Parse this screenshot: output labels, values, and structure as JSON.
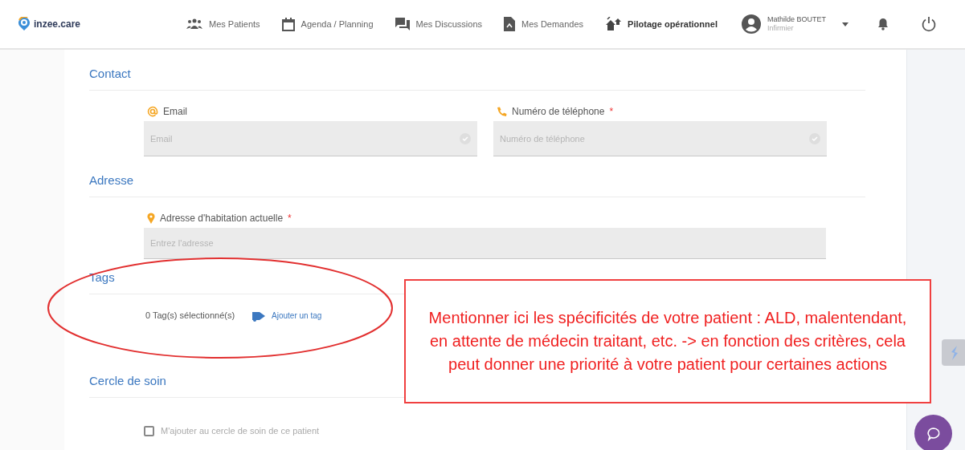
{
  "header": {
    "logo": "inzee.care",
    "nav": [
      {
        "label": "Mes Patients",
        "selected": false
      },
      {
        "label": "Agenda / Planning",
        "selected": false
      },
      {
        "label": "Mes Discussions",
        "selected": false
      },
      {
        "label": "Mes Demandes",
        "selected": false
      },
      {
        "label": "Pilotage opérationnel",
        "selected": true
      }
    ],
    "user": {
      "name": "Mathilde BOUTET",
      "role": "Infirmier"
    }
  },
  "sections": [
    {
      "title": "Contact",
      "kind": "fields",
      "fields": [
        {
          "label": "Email",
          "placeholder": "Email",
          "verified": true
        },
        {
          "label": "Numéro de téléphone",
          "required_mark": "*",
          "placeholder": "Numéro de téléphone",
          "verified": true
        }
      ]
    },
    {
      "title": "Adresse",
      "kind": "fields",
      "fields": [
        {
          "label": "Adresse d'habitation actuelle",
          "required_mark": "*",
          "placeholder": "Entrez l'adresse",
          "verified": false
        }
      ]
    },
    {
      "title": "Tags",
      "kind": "tags",
      "count": "0 Tag(s) sélectionné(s)",
      "action": "Ajouter un tag"
    },
    {
      "title": "Cercle de soin",
      "kind": "checkbox",
      "label": "M'ajouter au cercle de soin de ce patient",
      "checked": false
    }
  ],
  "annotation": {
    "text": "Mentionner ici les spécificités de votre patient : ALD, malentendant, en attente de médecin traitant, etc. -> en fonction des critères, cela peut donner une priorité à votre patient pour certaines actions"
  }
}
